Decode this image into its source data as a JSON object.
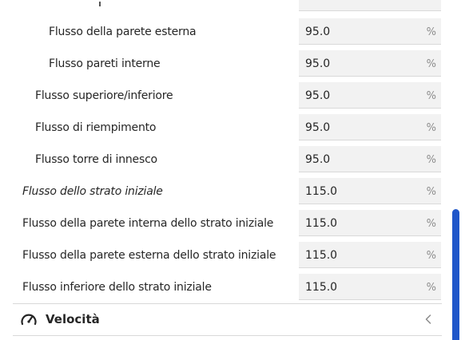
{
  "settings": {
    "rows": [
      {
        "label": "Flusso della parete esterna",
        "value": "95.0",
        "unit": "%",
        "italic": false
      },
      {
        "label": "Flusso pareti interne",
        "value": "95.0",
        "unit": "%",
        "italic": false
      },
      {
        "label": "Flusso superiore/inferiore",
        "value": "95.0",
        "unit": "%",
        "italic": false
      },
      {
        "label": "Flusso di riempimento",
        "value": "95.0",
        "unit": "%",
        "italic": false
      },
      {
        "label": "Flusso torre di innesco",
        "value": "95.0",
        "unit": "%",
        "italic": false
      },
      {
        "label": "Flusso dello strato iniziale",
        "value": "115.0",
        "unit": "%",
        "italic": true
      },
      {
        "label": "Flusso della parete interna dello strato iniziale",
        "value": "115.0",
        "unit": "%",
        "italic": false
      },
      {
        "label": "Flusso della parete esterna dello strato iniziale",
        "value": "115.0",
        "unit": "%",
        "italic": false
      },
      {
        "label": "Flusso inferiore dello strato iniziale",
        "value": "115.0",
        "unit": "%",
        "italic": false
      }
    ]
  },
  "section": {
    "title": "Velocità",
    "icon": "speedometer-icon",
    "collapse_icon": "chevron-left-icon"
  },
  "colors": {
    "field_bg": "#f2f2f2",
    "scrollbar": "#1f56c9",
    "text": "#262626",
    "unit_text": "#8c8c8c"
  }
}
